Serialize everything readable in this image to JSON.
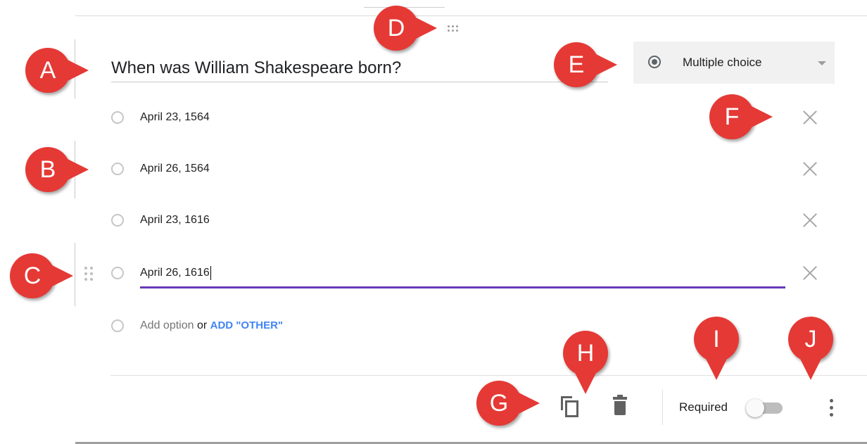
{
  "question": {
    "title": "When was William Shakespeare born?"
  },
  "type_select": {
    "label": "Multiple choice",
    "icon": "radio-button-checked-icon"
  },
  "options": [
    {
      "label": "April 23, 1564"
    },
    {
      "label": "April 26, 1564"
    },
    {
      "label": "April 23, 1616"
    },
    {
      "label": "April 26, 1616"
    }
  ],
  "add_option": {
    "label": "Add option",
    "or": " or ",
    "other": "ADD \"OTHER\""
  },
  "footer": {
    "required_label": "Required",
    "required_on": false
  },
  "callouts": {
    "a": "A",
    "b": "B",
    "c": "C",
    "d": "D",
    "e": "E",
    "f": "F",
    "g": "G",
    "h": "H",
    "i": "I",
    "j": "J"
  },
  "colors": {
    "accent": "#673ab7",
    "link": "#4285f4",
    "callout": "#e53935"
  }
}
